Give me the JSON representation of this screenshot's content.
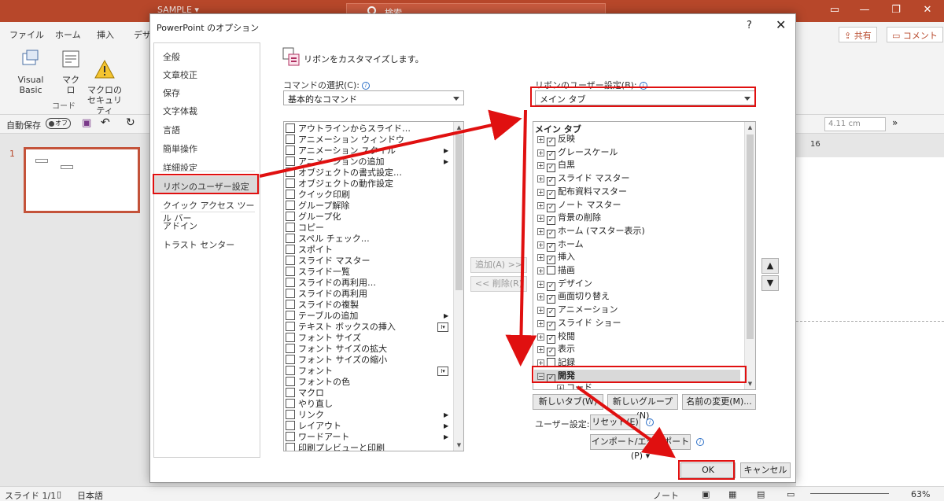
{
  "titlebar": {
    "app_name": "SAMPLE ▾",
    "search_placeholder": "検索"
  },
  "ribbon": {
    "tabs": [
      "ファイル",
      "ホーム",
      "挿入",
      "デザ"
    ],
    "share_label": "共有",
    "comment_label": "コメント",
    "items": [
      {
        "label": "Visual Basic"
      },
      {
        "label": "マクロ"
      },
      {
        "label": "マクロの\nセキュリティ"
      }
    ],
    "group_label": "コード"
  },
  "qat": {
    "autosave_label": "自動保存",
    "toggle_label": "オフ",
    "size_value": "4.11 cm"
  },
  "slides": {
    "thumb_number": "1"
  },
  "ruler": {
    "mark": "16"
  },
  "statusbar": {
    "slide_info": "スライド 1/1",
    "language": "日本語",
    "notes_label": "ノート",
    "zoom": "63%"
  },
  "dialog": {
    "title": "PowerPoint のオプション",
    "help_glyph": "?",
    "close_glyph": "✕",
    "nav_items": [
      {
        "label": "全般"
      },
      {
        "label": "文章校正"
      },
      {
        "label": "保存"
      },
      {
        "label": "文字体裁"
      },
      {
        "label": "言語"
      },
      {
        "label": "簡単操作"
      },
      {
        "label": "詳細設定"
      },
      {
        "label": "リボンのユーザー設定",
        "selected": true
      },
      {
        "label": "クイック アクセス ツール バー"
      },
      {
        "label": "アドイン"
      },
      {
        "label": "トラスト センター"
      }
    ],
    "header_text": "リボンをカスタマイズします。",
    "commands_label": "コマンドの選択(C):",
    "commands_value": "基本的なコマンド",
    "ribbon_label": "リボンのユーザー設定(B):",
    "ribbon_value": "メイン タブ",
    "commands": [
      "アウトラインからスライド…",
      "アニメーション ウィンドウ",
      "アニメーション スタイル",
      "アニメーションの追加",
      "オブジェクトの書式設定…",
      "オブジェクトの動作設定",
      "クイック印刷",
      "グループ解除",
      "グループ化",
      "コピー",
      "スペル チェック…",
      "スポイト",
      "スライド マスター",
      "スライド一覧",
      "スライドの再利用…",
      "スライドの再利用",
      "スライドの複製",
      "テーブルの追加",
      "テキスト ボックスの挿入",
      "フォント サイズ",
      "フォント サイズの拡大",
      "フォント サイズの縮小",
      "フォント",
      "フォントの色",
      "マクロ",
      "やり直し",
      "リンク",
      "レイアウト",
      "ワードアート",
      "印刷プレビューと印刷"
    ],
    "add_button": "追加(A) >>",
    "remove_button": "<< 削除(R)",
    "tree_header": "メイン タブ",
    "tree_items": [
      {
        "label": "反映",
        "checked": true
      },
      {
        "label": "グレースケール",
        "checked": true
      },
      {
        "label": "白黒",
        "checked": true
      },
      {
        "label": "スライド マスター",
        "checked": true
      },
      {
        "label": "配布資料マスター",
        "checked": true
      },
      {
        "label": "ノート マスター",
        "checked": true
      },
      {
        "label": "背景の削除",
        "checked": true
      },
      {
        "label": "ホーム (マスター表示)",
        "checked": true
      },
      {
        "label": "ホーム",
        "checked": true
      },
      {
        "label": "挿入",
        "checked": true
      },
      {
        "label": "描画",
        "checked": false
      },
      {
        "label": "デザイン",
        "checked": true
      },
      {
        "label": "画面切り替え",
        "checked": true
      },
      {
        "label": "アニメーション",
        "checked": true
      },
      {
        "label": "スライド ショー",
        "checked": true
      },
      {
        "label": "校閲",
        "checked": true
      },
      {
        "label": "表示",
        "checked": true
      },
      {
        "label": "記録",
        "checked": false
      },
      {
        "label": "開発",
        "checked": true,
        "selected": true,
        "expanded": true
      }
    ],
    "tree_child": "コード",
    "new_tab_button": "新しいタブ(W)",
    "new_group_button": "新しいグループ(N)",
    "rename_button": "名前の変更(M)...",
    "user_settings_label": "ユーザー設定:",
    "reset_button": "リセット(E) ▾",
    "import_export_button": "インポート/エクスポート(P) ▾",
    "ok_button": "OK",
    "cancel_button": "キャンセル"
  },
  "colors": {
    "accent": "#b7472a",
    "annotation": "#e01010"
  }
}
